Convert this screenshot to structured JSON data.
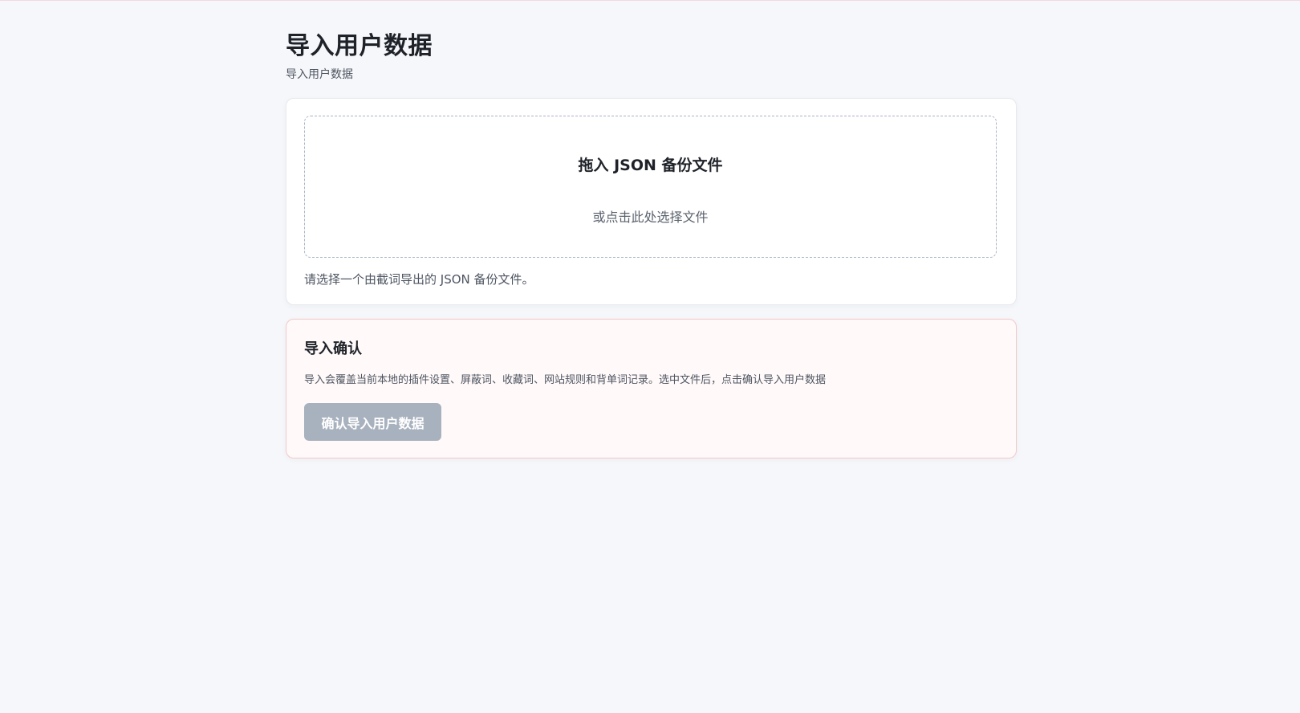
{
  "page": {
    "title": "导入用户数据",
    "subtitle": "导入用户数据"
  },
  "upload": {
    "dropzone_title": "拖入 JSON 备份文件",
    "dropzone_subtitle": "或点击此处选择文件",
    "hint": "请选择一个由截词导出的 JSON 备份文件。"
  },
  "confirm": {
    "title": "导入确认",
    "description": "导入会覆盖当前本地的插件设置、屏蔽词、收藏词、网站规则和背单词记录。选中文件后，点击确认导入用户数据",
    "button_label": "确认导入用户数据",
    "button_disabled": true
  },
  "colors": {
    "background": "#f6f7fa",
    "card": "#ffffff",
    "confirm_card": "#fff9f9",
    "confirm_border": "#f3c9cb",
    "disabled_button": "#a8b1be"
  }
}
